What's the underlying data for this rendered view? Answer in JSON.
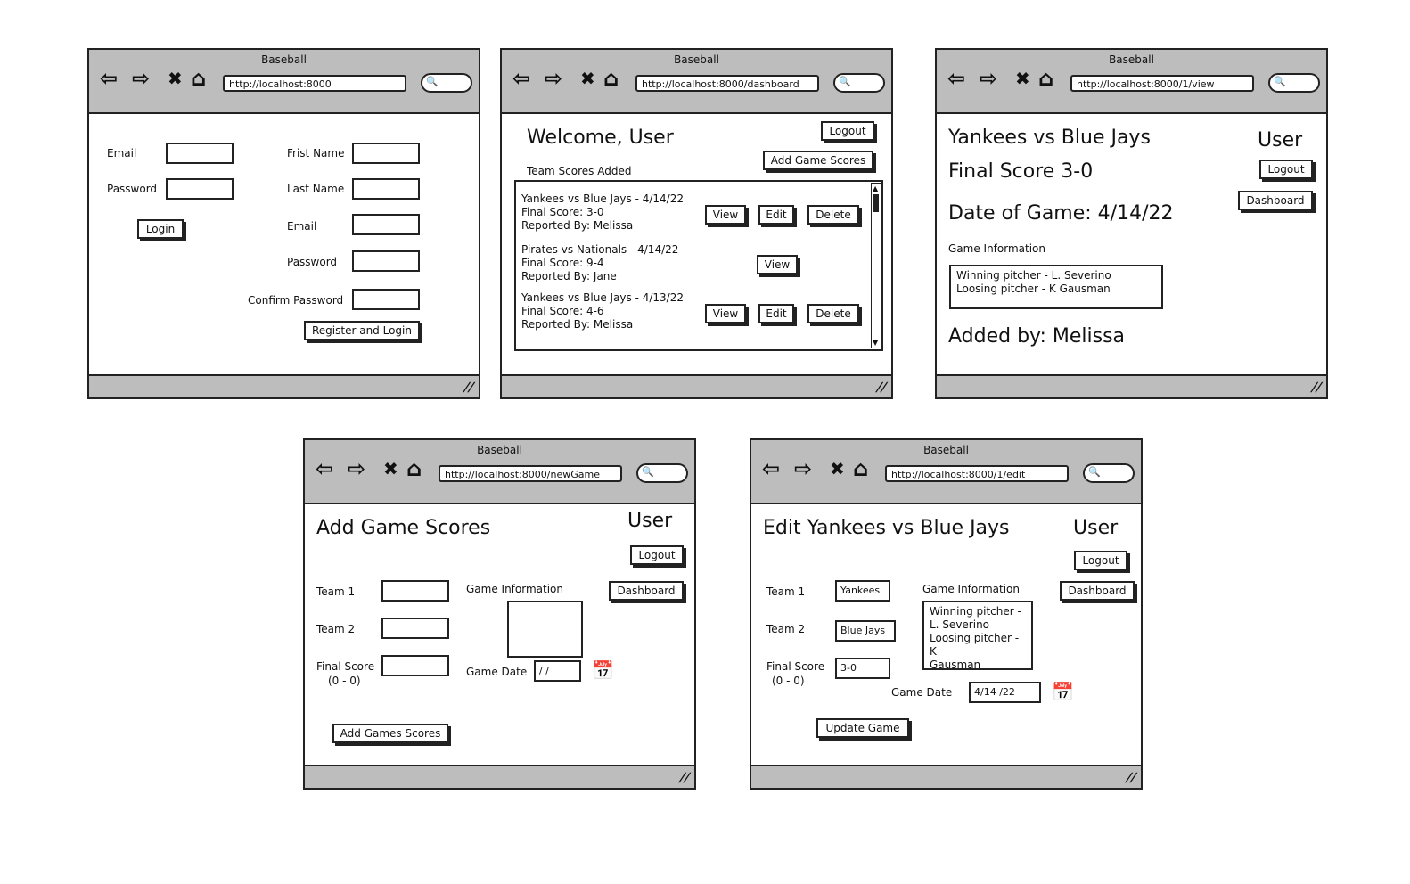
{
  "app_title": "Baseball",
  "nav": {
    "back": "⇦",
    "forward": "⇨",
    "stop": "✖",
    "home": "⌂",
    "search": "🔍"
  },
  "login_window": {
    "url": "http://localhost:8000",
    "email_label": "Email",
    "password_label": "Password",
    "login_button": "Login",
    "first_name_label": "Frist Name",
    "last_name_label": "Last Name",
    "reg_email_label": "Email",
    "reg_password_label": "Password",
    "confirm_password_label": "Confirm Password",
    "register_button": "Register and Login"
  },
  "dashboard_window": {
    "url": "http://localhost:8000/dashboard",
    "welcome": "Welcome, User",
    "logout_button": "Logout",
    "add_button": "Add Game Scores",
    "list_heading": "Team Scores Added",
    "games": [
      {
        "title": "Yankees vs Blue Jays - 4/14/22",
        "score": "Final Score: 3-0",
        "reporter": "Reported By: Melissa",
        "view": "View",
        "edit": "Edit",
        "delete": "Delete"
      },
      {
        "title": "Pirates vs Nationals - 4/14/22",
        "score": "Final Score: 9-4",
        "reporter": "Reported By: Jane",
        "view": "View"
      },
      {
        "title": "Yankees vs Blue Jays - 4/13/22",
        "score": "Final Score: 4-6",
        "reporter": "Reported By: Melissa",
        "view": "View",
        "edit": "Edit",
        "delete": "Delete"
      }
    ]
  },
  "view_window": {
    "url": "http://localhost:8000/1/view",
    "title": "Yankees vs Blue Jays",
    "final_score": "Final Score 3-0",
    "date": "Date of Game: 4/14/22",
    "user": "User",
    "logout_button": "Logout",
    "dashboard_button": "Dashboard",
    "info_label": "Game Information",
    "info_line1": "Winning pitcher - L. Severino",
    "info_line2": "Loosing pitcher - K Gausman",
    "added_by": "Added by: Melissa"
  },
  "new_window": {
    "url": "http://localhost:8000/newGame",
    "title": "Add Game Scores",
    "user": "User",
    "logout_button": "Logout",
    "dashboard_button": "Dashboard",
    "team1_label": "Team 1",
    "team2_label": "Team 2",
    "final_score_label": "Final Score",
    "final_score_hint": "(0 - 0)",
    "info_label": "Game Information",
    "date_label": "Game Date",
    "date_value": "/ /",
    "add_button": "Add Games Scores"
  },
  "edit_window": {
    "url": "http://localhost:8000/1/edit",
    "title": "Edit Yankees vs Blue Jays",
    "user": "User",
    "logout_button": "Logout",
    "dashboard_button": "Dashboard",
    "team1_label": "Team 1",
    "team1_value": "Yankees",
    "team2_label": "Team 2",
    "team2_value": "Blue Jays",
    "final_score_label": "Final Score",
    "final_score_hint": "(0 - 0)",
    "final_score_value": "3-0",
    "info_label": "Game Information",
    "info_line1": "Winning pitcher -",
    "info_line2": "L. Severino",
    "info_line3": "Loosing pitcher - K",
    "info_line4": "Gausman",
    "date_label": "Game Date",
    "date_value": "4/14 /22",
    "update_button": "Update Game"
  },
  "icons": {
    "calendar": "📅",
    "grip": "//"
  }
}
